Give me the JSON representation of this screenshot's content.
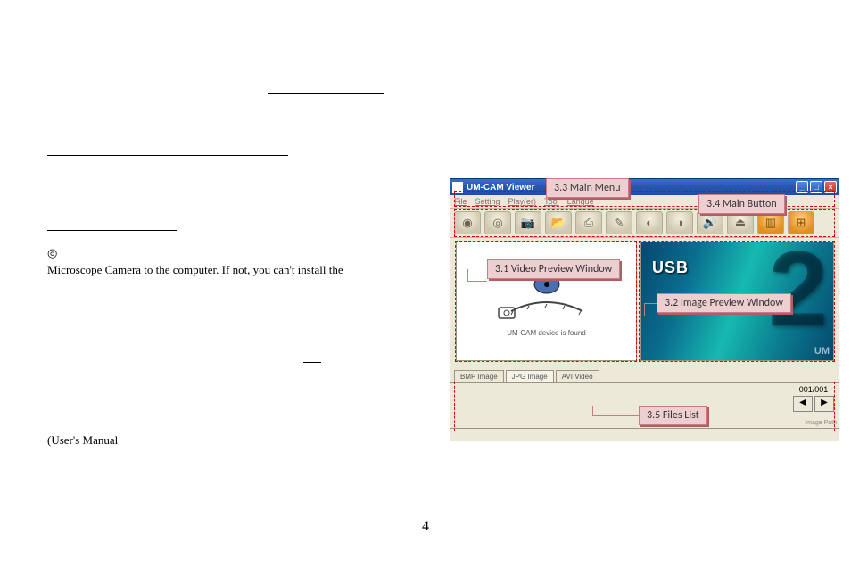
{
  "left_text": {
    "note_symbol": "◎",
    "line1": "Microscope Camera to the computer. If not, you can't install the",
    "users_manual": "(User's  Manual"
  },
  "page_number": "4",
  "app": {
    "title": "UM-CAM Viewer",
    "window_controls": {
      "min": "_",
      "max": "□",
      "close": "×"
    },
    "menus": [
      "File",
      "Setting",
      "Play(er)",
      "Tool",
      "Langue"
    ],
    "toolbar": {
      "btn1": "◉",
      "btn2": "◎",
      "btn3": "📷",
      "btn4": "📂",
      "btn5": "⎙",
      "btn6": "✎",
      "btn7": "◐",
      "btn8": "◑",
      "btn9": "🔊",
      "btn10": "⏏",
      "btn11": "▥",
      "btn12": "⊞"
    },
    "video_msg": "UM-CAM device is found",
    "image_preview": {
      "usb": "USB",
      "big": "2",
      "um": "UM"
    },
    "tabs": [
      "BMP Image",
      "JPG Image",
      "AVI Video"
    ],
    "counter": "001/001",
    "pager": {
      "prev": "◀",
      "next": "▶"
    },
    "image_path_label": "Image Path"
  },
  "callouts": {
    "c33": "3.3 Main Menu",
    "c34": "3.4 Main Button",
    "c31": "3.1 Video Preview Window",
    "c32": "3.2 Image Preview Window",
    "c35": "3.5 Files List"
  }
}
